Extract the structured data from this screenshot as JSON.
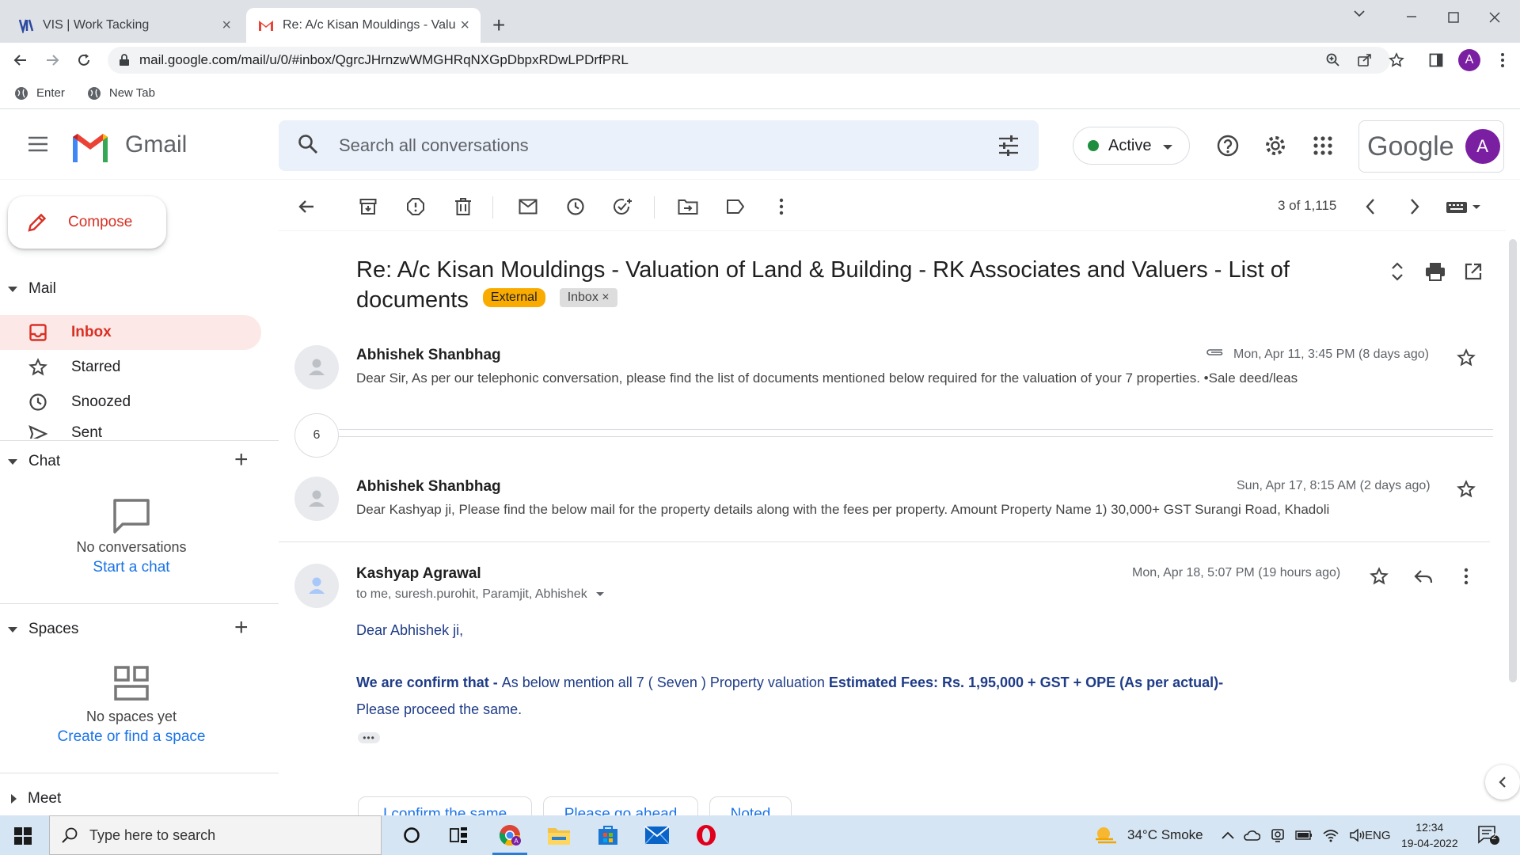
{
  "browser": {
    "tabs": [
      {
        "title": "VIS | Work Tacking"
      },
      {
        "title": "Re: A/c Kisan Mouldings - Valuation of Land & Building"
      }
    ],
    "url": "mail.google.com/mail/u/0/#inbox/QgrcJHrnzwWMGHRqNXGpDbpxRDwLPDrfPRL",
    "profile_initial": "A",
    "bookmarks": [
      "Enter",
      "New Tab"
    ]
  },
  "gmail": {
    "product_name": "Gmail",
    "search_placeholder": "Search all conversations",
    "status": "Active",
    "google_word": "Google",
    "avatar_initial": "A"
  },
  "sidebar": {
    "compose_label": "Compose",
    "mail_section": "Mail",
    "items": [
      {
        "label": "Inbox",
        "selected": true
      },
      {
        "label": "Starred"
      },
      {
        "label": "Snoozed"
      },
      {
        "label": "Sent"
      }
    ],
    "chat_section": "Chat",
    "chat_empty": "No conversations",
    "chat_link": "Start a chat",
    "spaces_section": "Spaces",
    "spaces_empty": "No spaces yet",
    "spaces_link": "Create or find a space",
    "meet_section": "Meet"
  },
  "toolbar": {
    "pager": "3 of 1,115"
  },
  "thread": {
    "subject": "Re: A/c Kisan Mouldings - Valuation of Land & Building - RK Associates and Valuers - List of documents",
    "chip_external": "External",
    "chip_inbox": "Inbox",
    "collapsed_count": "6",
    "messages": [
      {
        "sender": "Abhishek Shanbhag",
        "date": "Mon, Apr 11, 3:45 PM (8 days ago)",
        "snippet": "Dear Sir, As per our telephonic conversation, please find the list of documents mentioned below required for the valuation of your 7 properties. •Sale deed/leas"
      },
      {
        "sender": "Abhishek Shanbhag",
        "date": "Sun, Apr 17, 8:15 AM (2 days ago)",
        "snippet": "Dear Kashyap ji, Please find the below mail for the property details along with the fees per property. Amount Property Name 1) 30,000+ GST Surangi Road, Khadoli"
      },
      {
        "sender": "Kashyap Agrawal",
        "date": "Mon, Apr 18, 5:07 PM (19 hours ago)",
        "to": "to me, suresh.purohit, Paramjit, Abhishek"
      }
    ],
    "body": {
      "greeting": "Dear Abhishek ji,",
      "line1_bold": "We are confirm that - ",
      "line1_normal": " As below mention all 7 ( Seven ) Property valuation ",
      "line1_bold2": "Estimated Fees: Rs. 1,95,000 + GST + OPE (As per actual)-",
      "line2": "Please proceed the same."
    },
    "smart_replies": [
      "I confirm the same",
      "Please go ahead",
      "Noted"
    ]
  },
  "taskbar": {
    "search_placeholder": "Type here to search",
    "weather": "34°C  Smoke",
    "lang": "ENG",
    "time": "12:34",
    "date": "19-04-2022",
    "notif_count": "2"
  }
}
